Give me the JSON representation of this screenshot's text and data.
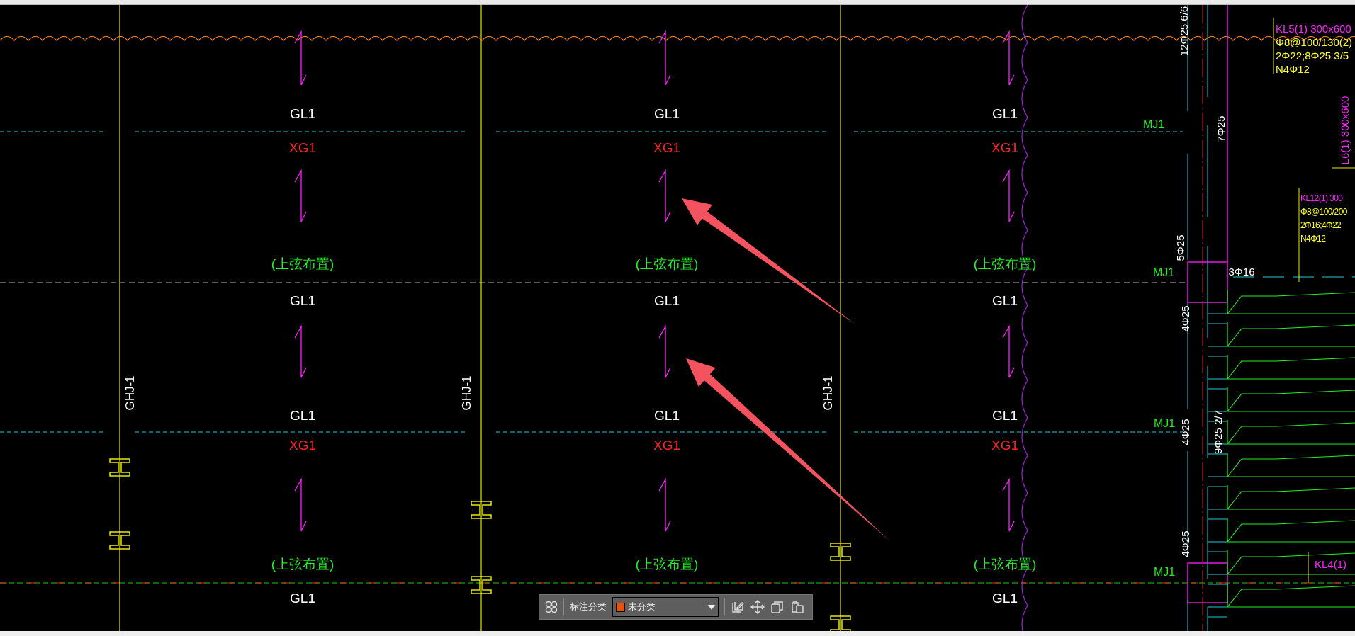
{
  "drawing": {
    "bays": [
      {
        "labels": [
          {
            "text": "GL1",
            "kind": "beam"
          },
          {
            "text": "XG1",
            "kind": "brace"
          },
          {
            "text": "(上弦布置)",
            "kind": "note"
          },
          {
            "text": "GL1",
            "kind": "beam"
          },
          {
            "text": "GL1",
            "kind": "beam"
          },
          {
            "text": "XG1",
            "kind": "brace"
          },
          {
            "text": "(上弦布置)",
            "kind": "note"
          },
          {
            "text": "GL1",
            "kind": "beam"
          }
        ]
      },
      {
        "labels": [
          {
            "text": "GL1",
            "kind": "beam"
          },
          {
            "text": "XG1",
            "kind": "brace"
          },
          {
            "text": "(上弦布置)",
            "kind": "note"
          },
          {
            "text": "GL1",
            "kind": "beam"
          },
          {
            "text": "GL1",
            "kind": "beam"
          },
          {
            "text": "XG1",
            "kind": "brace"
          },
          {
            "text": "(上弦布置)",
            "kind": "note"
          }
        ]
      },
      {
        "labels": [
          {
            "text": "GL1",
            "kind": "beam"
          },
          {
            "text": "XG1",
            "kind": "brace"
          },
          {
            "text": "(上弦布置)",
            "kind": "note"
          },
          {
            "text": "GL1",
            "kind": "beam"
          },
          {
            "text": "GL1",
            "kind": "beam"
          },
          {
            "text": "XG1",
            "kind": "brace"
          },
          {
            "text": "(上弦布置)",
            "kind": "note"
          },
          {
            "text": "GL1",
            "kind": "beam"
          }
        ]
      }
    ],
    "column_tags": [
      "GHJ-1",
      "GHJ-1",
      "GHJ-1"
    ],
    "rebar_marks": [
      "12Φ25 6/6",
      "7Φ25",
      "5Φ25",
      "3Φ16",
      "4Φ25",
      "4Φ25",
      "9Φ25 2/7",
      "4Φ25"
    ],
    "wall_tags": [
      "MJ1",
      "MJ1",
      "MJ1",
      "MJ1"
    ],
    "beam_notes": [
      {
        "lines": [
          "KL5(1) 300x600",
          "Φ8@100/130(2)",
          "2Φ22;8Φ25 3/5",
          "N4Φ12"
        ]
      },
      {
        "lines": [
          "L6(1) 300x600"
        ]
      },
      {
        "lines": [
          "KL12(1) 300",
          "Φ8@100/200",
          "2Φ16;4Φ22",
          "N4Φ12"
        ]
      },
      {
        "lines": [
          "KL4(1)"
        ]
      }
    ]
  },
  "toolbar": {
    "label": "标注分类",
    "category": {
      "value": "未分类",
      "color": "#e8510a"
    }
  }
}
